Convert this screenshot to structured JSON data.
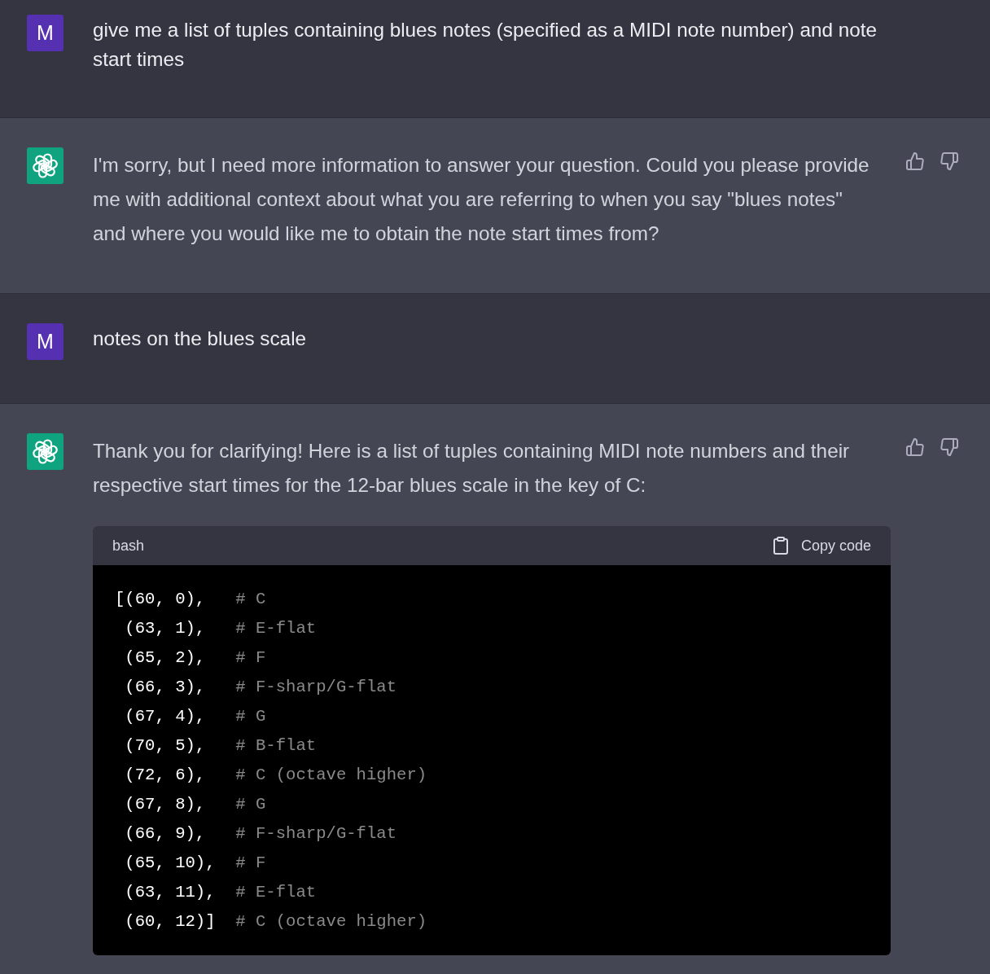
{
  "messages": [
    {
      "kind": "user",
      "avatar": "M",
      "text": "give me a list of tuples containing blues notes (specified as a MIDI note number) and note start times"
    },
    {
      "kind": "assistant",
      "paragraphs": [
        "I'm sorry, but I need more information to answer your question. Could you please provide me with additional context about what you are referring to when you say \"blues notes\" and where you would like me to obtain the note start times from?"
      ]
    },
    {
      "kind": "user",
      "avatar": "M",
      "text": "notes on the blues scale"
    },
    {
      "kind": "assistant",
      "paragraphs": [
        "Thank you for clarifying! Here is a list of tuples containing MIDI note numbers and their respective start times for the 12-bar blues scale in the key of C:"
      ],
      "code": {
        "language": "bash",
        "copy_label": "Copy code",
        "lines": [
          {
            "code": "[(60, 0),",
            "comment": "# C"
          },
          {
            "code": " (63, 1),",
            "comment": "# E-flat"
          },
          {
            "code": " (65, 2),",
            "comment": "# F"
          },
          {
            "code": " (66, 3),",
            "comment": "# F-sharp/G-flat"
          },
          {
            "code": " (67, 4),",
            "comment": "# G"
          },
          {
            "code": " (70, 5),",
            "comment": "# B-flat"
          },
          {
            "code": " (72, 6),",
            "comment": "# C (octave higher)"
          },
          {
            "code": " (67, 8),",
            "comment": "# G"
          },
          {
            "code": " (66, 9),",
            "comment": "# F-sharp/G-flat"
          },
          {
            "code": " (65, 10),",
            "comment": "# F"
          },
          {
            "code": " (63, 11),",
            "comment": "# E-flat"
          },
          {
            "code": " (60, 12)]",
            "comment": "# C (octave higher)"
          }
        ]
      }
    }
  ]
}
